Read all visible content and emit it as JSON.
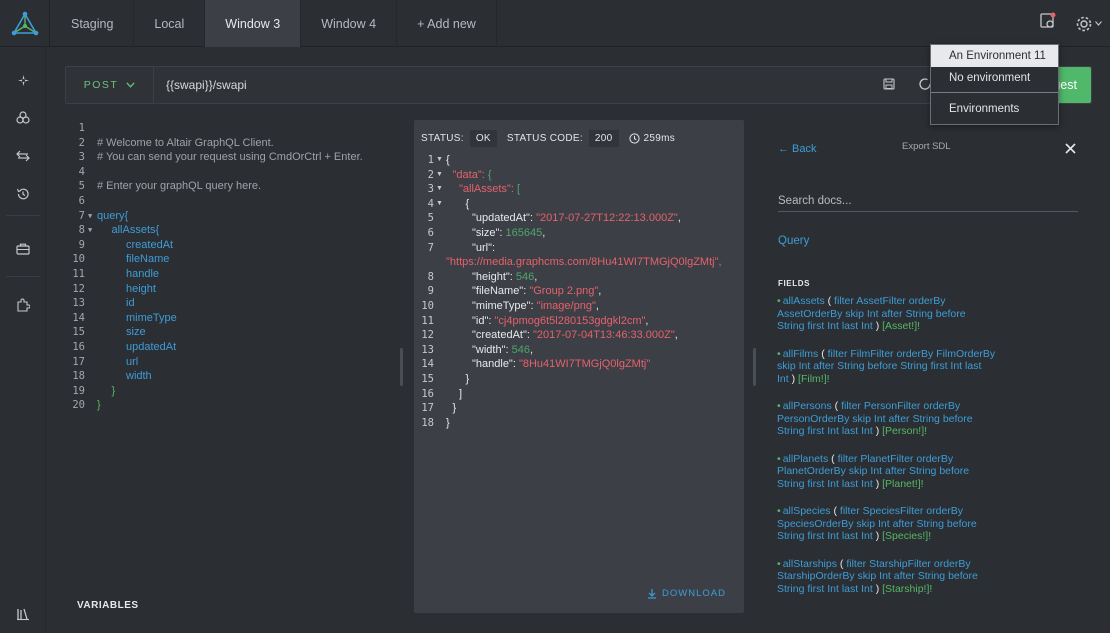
{
  "tabs": [
    "Staging",
    "Local",
    "Window 3",
    "Window 4",
    "+ Add new"
  ],
  "active_tab": 2,
  "request": {
    "method": "POST",
    "url": "{{swapi}}/swapi",
    "send_label": "uest"
  },
  "env_dropdown": {
    "items": [
      "An Environment 11",
      "No environment"
    ],
    "footer": "Environments"
  },
  "query_lines": [
    "",
    "# Welcome to Altair GraphQL Client.",
    "# You can send your request using CmdOrCtrl + Enter.",
    "",
    "# Enter your graphQL query here.",
    "",
    "query{",
    "allAssets{",
    "createdAt",
    "fileName",
    "handle",
    "height",
    "id",
    "mimeType",
    "size",
    "updatedAt",
    "url",
    "width",
    "}",
    "}"
  ],
  "variables_label": "VARIABLES",
  "result": {
    "status_label": "STATUS:",
    "status": "OK",
    "code_label": "STATUS CODE:",
    "code": "200",
    "time": "259ms",
    "download_label": "DOWNLOAD"
  },
  "result_lines": [
    "{",
    "\"data\": {",
    "\"allAssets\": [",
    "{",
    "\"updatedAt\": \"2017-07-27T12:22:13.000Z\",",
    "\"size\": 165645,",
    "\"url\":",
    "\"https://media.graphcms.com/8Hu41WI7TMGjQ0lgZMtj\",",
    "\"height\": 546,",
    "\"fileName\": \"Group 2.png\",",
    "\"mimeType\": \"image/png\",",
    "\"id\": \"cj4pmog6t5l280153gdgkl2cm\",",
    "\"createdAt\": \"2017-07-04T13:46:33.000Z\",",
    "\"width\": 546,",
    "\"handle\": \"8Hu41WI7TMGjQ0lgZMtj\"",
    "}",
    "]",
    "}",
    "}"
  ],
  "docs": {
    "back": "← Back",
    "export": "Export SDL",
    "search_placeholder": "Search docs...",
    "query": "Query",
    "fields_heading": "FIELDS",
    "fields": [
      {
        "name": "allAssets",
        "l1": [
          "filter",
          "AssetFilter",
          "orderBy"
        ],
        "l2": [
          "AssetOrderBy",
          "skip",
          "Int",
          "after",
          "String",
          "before"
        ],
        "l3": [
          "String",
          "first",
          "Int",
          "last",
          "Int"
        ],
        "ret": "[Asset!]!"
      },
      {
        "name": "allFilms",
        "l1": [
          "filter",
          "FilmFilter",
          "orderBy",
          "FilmOrderBy"
        ],
        "l2": [
          "skip",
          "Int",
          "after",
          "String",
          "before",
          "String",
          "first",
          "Int",
          "last"
        ],
        "l3": [
          "Int"
        ],
        "ret": "[Film!]!"
      },
      {
        "name": "allPersons",
        "l1": [
          "filter",
          "PersonFilter",
          "orderBy"
        ],
        "l2": [
          "PersonOrderBy",
          "skip",
          "Int",
          "after",
          "String",
          "before"
        ],
        "l3": [
          "String",
          "first",
          "Int",
          "last",
          "Int"
        ],
        "ret": "[Person!]!"
      },
      {
        "name": "allPlanets",
        "l1": [
          "filter",
          "PlanetFilter",
          "orderBy"
        ],
        "l2": [
          "PlanetOrderBy",
          "skip",
          "Int",
          "after",
          "String",
          "before"
        ],
        "l3": [
          "String",
          "first",
          "Int",
          "last",
          "Int"
        ],
        "ret": "[Planet!]!"
      },
      {
        "name": "allSpecies",
        "l1": [
          "filter",
          "SpeciesFilter",
          "orderBy"
        ],
        "l2": [
          "SpeciesOrderBy",
          "skip",
          "Int",
          "after",
          "String",
          "before"
        ],
        "l3": [
          "String",
          "first",
          "Int",
          "last",
          "Int"
        ],
        "ret": "[Species!]!"
      },
      {
        "name": "allStarships",
        "l1": [
          "filter",
          "StarshipFilter",
          "orderBy"
        ],
        "l2": [
          "StarshipOrderBy",
          "skip",
          "Int",
          "after",
          "String",
          "before"
        ],
        "l3": [
          "String",
          "first",
          "Int",
          "last",
          "Int"
        ],
        "ret": "[Starship!]!"
      }
    ]
  },
  "colors": {
    "accent_green": "#4fb86b",
    "link_blue": "#3e9dd6",
    "string_red": "#e5616b"
  }
}
